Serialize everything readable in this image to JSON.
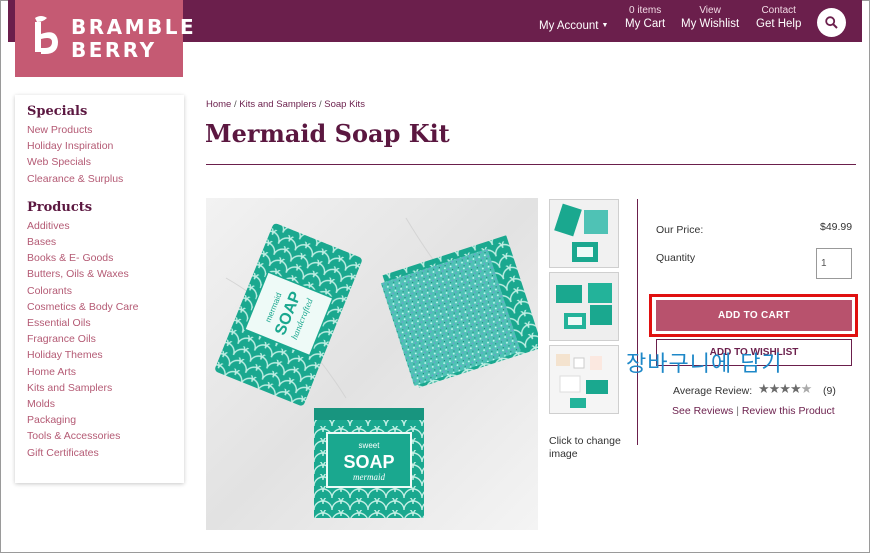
{
  "brand": {
    "line1": "BRAMBLE",
    "line2": "BERRY"
  },
  "nav": {
    "account": "My Account",
    "cart_small": "0 items",
    "cart": "My Cart",
    "wishlist_small": "View",
    "wishlist": "My Wishlist",
    "help_small": "Contact",
    "help": "Get Help"
  },
  "sidebar": {
    "specials_heading": "Specials",
    "specials": [
      "New Products",
      "Holiday Inspiration",
      "Web Specials",
      "Clearance & Surplus"
    ],
    "products_heading": "Products",
    "products": [
      "Additives",
      "Bases",
      "Books & E- Goods",
      "Butters, Oils & Waxes",
      "Colorants",
      "Cosmetics & Body Care",
      "Essential Oils",
      "Fragrance Oils",
      "Holiday Themes",
      "Home Arts",
      "Kits and Samplers",
      "Molds",
      "Packaging",
      "Tools & Accessories",
      "Gift Certificates"
    ]
  },
  "breadcrumb": {
    "home": "Home",
    "category": "Kits and Samplers",
    "current": "Soap Kits"
  },
  "product": {
    "title": "Mermaid Soap Kit",
    "price_label": "Our Price:",
    "price": "$49.99",
    "quantity_label": "Quantity",
    "quantity": "1",
    "add_to_cart": "ADD TO CART",
    "add_to_wishlist": "ADD TO WISHLIST",
    "annotation": "장바구니에 담기",
    "thumb_note": "Click to change image",
    "review_label": "Average Review:",
    "review_count": "(9)",
    "see_reviews": "See Reviews",
    "review_this": "Review this Product"
  },
  "soap_labels": {
    "top_small": "mermaid",
    "top_word": "SOAP",
    "top_script": "handcrafted",
    "bottom_small": "sweet",
    "bottom_word": "SOAP",
    "bottom_script": "mermaid"
  },
  "rating": {
    "value": 4.5,
    "max": 5
  },
  "colors": {
    "brand": "#6b1f4c",
    "logo_bg": "#c55a73",
    "button": "#b8526d",
    "highlight": "#e01010",
    "annotation": "#1e88c8",
    "teal": "#1aa88f"
  },
  "icons": {
    "search": "search-icon",
    "logo": "leaf-b-icon"
  }
}
